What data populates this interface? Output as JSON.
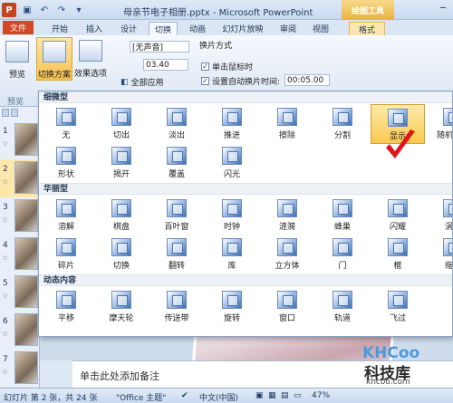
{
  "window": {
    "title": "母亲节电子相册.pptx - Microsoft PowerPoint",
    "context_tool": "绘图工具",
    "buttons": [
      "minimize",
      "restore",
      "close"
    ]
  },
  "tabs": [
    "文件",
    "开始",
    "插入",
    "设计",
    "切换",
    "动画",
    "幻灯片放映",
    "审阅",
    "视图",
    "格式"
  ],
  "active_tab": "切换",
  "ribbon": {
    "preview_label": "预览",
    "preview_group": "预览",
    "transition_scheme_label": "切换方案",
    "effect_options_label": "效果选项",
    "sound_value": "[无声音]",
    "duration_value": "03.40",
    "apply_all_label": "全部应用",
    "switch_mode_heading": "换片方式",
    "on_click_label": "单击鼠标时",
    "on_click_checked": true,
    "auto_label": "设置自动换片时间:",
    "auto_checked": true,
    "auto_time": "00:05.00"
  },
  "gallery": {
    "sections": [
      {
        "heading": "细微型",
        "items": [
          "无",
          "切出",
          "淡出",
          "推进",
          "擦除",
          "分割",
          "显示",
          "随机线条",
          "形状",
          "揭开",
          "覆盖",
          "闪光"
        ]
      },
      {
        "heading": "华丽型",
        "items": [
          "溶解",
          "棋盘",
          "百叶窗",
          "时钟",
          "涟漪",
          "蜂巢",
          "闪耀",
          "涡流",
          "碎片",
          "切换",
          "翻转",
          "库",
          "立方体",
          "门",
          "框",
          "缩放"
        ]
      },
      {
        "heading": "动态内容",
        "items": [
          "平移",
          "摩天轮",
          "传送带",
          "旋转",
          "窗口",
          "轨道",
          "飞过"
        ]
      }
    ],
    "selected_item": "显示"
  },
  "slide_pane": {
    "slides": [
      "1",
      "2",
      "3",
      "4",
      "5",
      "6",
      "7"
    ],
    "selected": "2"
  },
  "notes_placeholder": "单击此处添加备注",
  "status": {
    "slide_info": "幻灯片 第 2 张，共 24 张",
    "theme": "\"Office 主题\"",
    "language": "中文(中国)",
    "zoom": "47%"
  },
  "watermark": {
    "logo": "KHCoo",
    "name": "科技库",
    "url": "khcoo.com"
  },
  "colors": {
    "file_tab": "#d24726",
    "selection": "#f8c94f",
    "check": "#e0141e",
    "accent": "#2b579a"
  }
}
